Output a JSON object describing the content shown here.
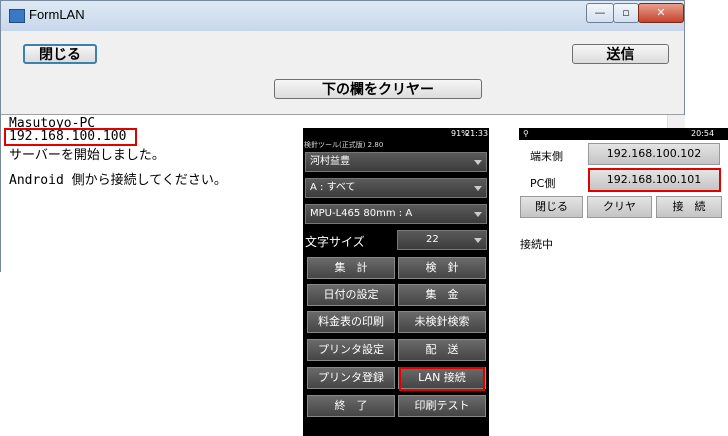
{
  "window": {
    "title": "FormLAN",
    "minimize_glyph": "—",
    "restore_glyph": "▫",
    "close_glyph": "✕"
  },
  "buttons": {
    "close_label": "閉じる",
    "send_label": "送信",
    "clear_label": "下の欄をクリヤー"
  },
  "log": {
    "line1": "Masutoyo-PC",
    "line2": "192.168.100.100",
    "line3": "サーバーを開始しました。",
    "line4": "Android 側から接続してください。"
  },
  "left_phone": {
    "status_left": "検針ツール(正式版) 2.80",
    "status_time": "21:33",
    "status_battery": "91%",
    "dropdowns": [
      "河村益豊",
      "A : すべて",
      "MPU-L465  80mm : A"
    ],
    "font_size_label": "文字サイズ",
    "font_size_value": "22",
    "menu": [
      [
        "集　計",
        "検　針"
      ],
      [
        "日付の設定",
        "集　金"
      ],
      [
        "料金表の印刷",
        "未検針検索"
      ],
      [
        "プリンタ設定",
        "配　送"
      ],
      [
        "プリンタ登録",
        "LAN 接続"
      ],
      [
        "終　了",
        "印刷テスト"
      ]
    ]
  },
  "right_phone": {
    "status_time": "20:54",
    "terminal_label": "端末側",
    "terminal_ip": "192.168.100.102",
    "pc_label": "PC側",
    "pc_ip": "192.168.100.101",
    "btn_close": "閉じる",
    "btn_clear": "クリヤ",
    "btn_connect": "接　続",
    "connecting_text": "接続中"
  },
  "colors": {
    "highlight": "#e00000",
    "accent": "#3c7fb1"
  }
}
